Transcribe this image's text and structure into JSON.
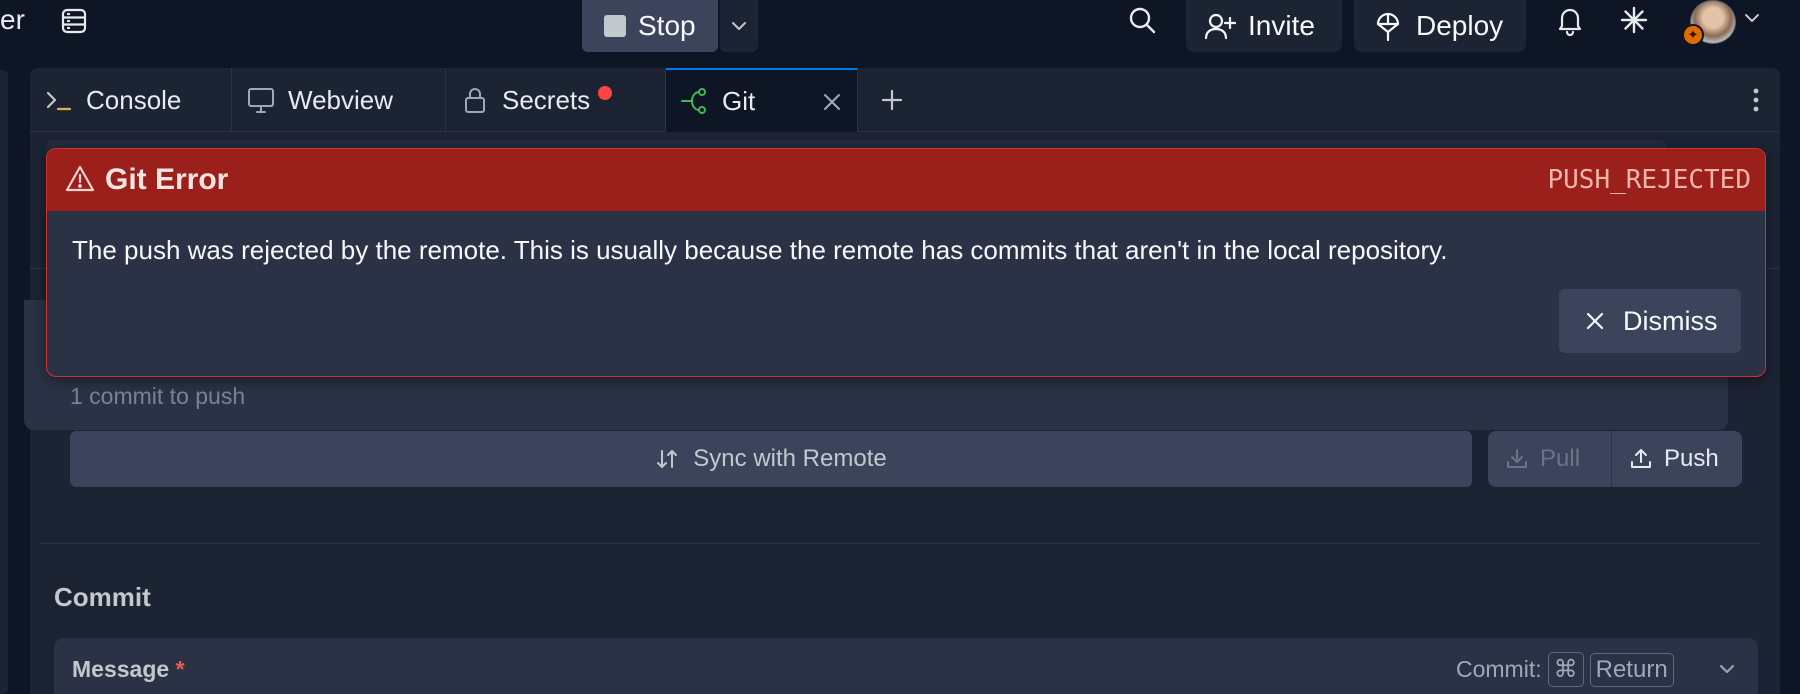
{
  "topbar": {
    "left_fragment": "er",
    "stop_label": "Stop",
    "invite_label": "Invite",
    "deploy_label": "Deploy"
  },
  "tabs": [
    {
      "label": "Console",
      "icon": "terminal-icon"
    },
    {
      "label": "Webview",
      "icon": "monitor-icon"
    },
    {
      "label": "Secrets",
      "icon": "lock-icon",
      "has_alert_dot": true
    },
    {
      "label": "Git",
      "icon": "git-branch-icon",
      "active": true
    }
  ],
  "error": {
    "title": "Git Error",
    "code": "PUSH_REJECTED",
    "message": "The push was rejected by the remote. This is usually because the remote has commits that aren't in the local repository.",
    "dismiss_label": "Dismiss"
  },
  "remote": {
    "commit_count_text": "1 commit to push",
    "sync_label": "Sync with Remote",
    "pull_label": "Pull",
    "push_label": "Push"
  },
  "commit": {
    "section_title": "Commit",
    "message_label": "Message",
    "required_mark": "*",
    "shortcut_prefix": "Commit:",
    "shortcut_key1": "⌘",
    "shortcut_key2": "Return"
  },
  "colors": {
    "background": "#0e1525",
    "surface": "#1c2333",
    "error_header": "#9b1f1a",
    "active_tab_accent": "#0079f2",
    "git_icon": "#3fb950",
    "alert_dot": "#ff4444"
  }
}
